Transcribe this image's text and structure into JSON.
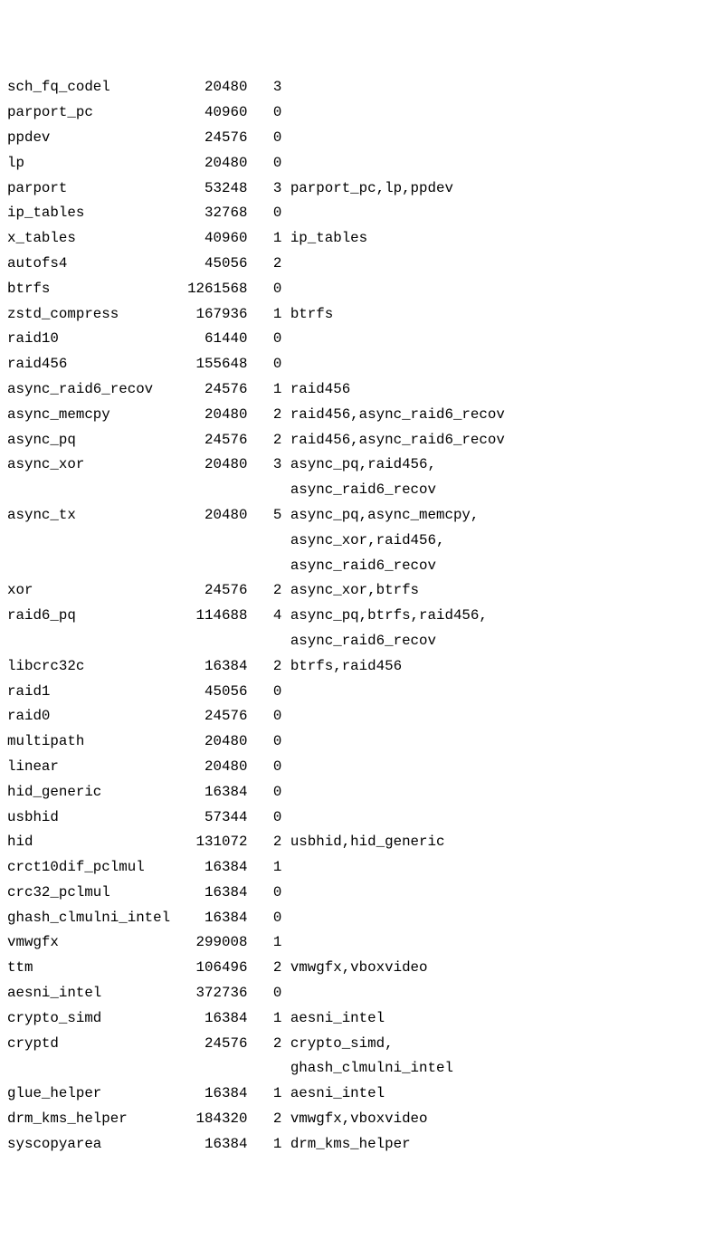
{
  "columns": {
    "nameWidth": 19,
    "sizeWidth": 9,
    "refWidth": 3,
    "usedWidth": 27
  },
  "modules": [
    {
      "name": "sch_fq_codel",
      "size": "20480",
      "ref": "3",
      "used": ""
    },
    {
      "name": "parport_pc",
      "size": "40960",
      "ref": "0",
      "used": ""
    },
    {
      "name": "ppdev",
      "size": "24576",
      "ref": "0",
      "used": ""
    },
    {
      "name": "lp",
      "size": "20480",
      "ref": "0",
      "used": ""
    },
    {
      "name": "parport",
      "size": "53248",
      "ref": "3",
      "used": "parport_pc,lp,ppdev"
    },
    {
      "name": "ip_tables",
      "size": "32768",
      "ref": "0",
      "used": ""
    },
    {
      "name": "x_tables",
      "size": "40960",
      "ref": "1",
      "used": "ip_tables"
    },
    {
      "name": "autofs4",
      "size": "45056",
      "ref": "2",
      "used": ""
    },
    {
      "name": "btrfs",
      "size": "1261568",
      "ref": "0",
      "used": ""
    },
    {
      "name": "zstd_compress",
      "size": "167936",
      "ref": "1",
      "used": "btrfs"
    },
    {
      "name": "raid10",
      "size": "61440",
      "ref": "0",
      "used": ""
    },
    {
      "name": "raid456",
      "size": "155648",
      "ref": "0",
      "used": ""
    },
    {
      "name": "async_raid6_recov",
      "size": "24576",
      "ref": "1",
      "used": "raid456"
    },
    {
      "name": "async_memcpy",
      "size": "20480",
      "ref": "2",
      "used": "raid456,async_raid6_recov"
    },
    {
      "name": "async_pq",
      "size": "24576",
      "ref": "2",
      "used": "raid456,async_raid6_recov"
    },
    {
      "name": "async_xor",
      "size": "20480",
      "ref": "3",
      "used": "async_pq,raid456,async_raid6_recov"
    },
    {
      "name": "async_tx",
      "size": "20480",
      "ref": "5",
      "used": "async_pq,async_memcpy,async_xor,raid456,async_raid6_recov"
    },
    {
      "name": "xor",
      "size": "24576",
      "ref": "2",
      "used": "async_xor,btrfs"
    },
    {
      "name": "raid6_pq",
      "size": "114688",
      "ref": "4",
      "used": "async_pq,btrfs,raid456,async_raid6_recov"
    },
    {
      "name": "libcrc32c",
      "size": "16384",
      "ref": "2",
      "used": "btrfs,raid456"
    },
    {
      "name": "raid1",
      "size": "45056",
      "ref": "0",
      "used": ""
    },
    {
      "name": "raid0",
      "size": "24576",
      "ref": "0",
      "used": ""
    },
    {
      "name": "multipath",
      "size": "20480",
      "ref": "0",
      "used": ""
    },
    {
      "name": "linear",
      "size": "20480",
      "ref": "0",
      "used": ""
    },
    {
      "name": "hid_generic",
      "size": "16384",
      "ref": "0",
      "used": ""
    },
    {
      "name": "usbhid",
      "size": "57344",
      "ref": "0",
      "used": ""
    },
    {
      "name": "hid",
      "size": "131072",
      "ref": "2",
      "used": "usbhid,hid_generic"
    },
    {
      "name": "crct10dif_pclmul",
      "size": "16384",
      "ref": "1",
      "used": ""
    },
    {
      "name": "crc32_pclmul",
      "size": "16384",
      "ref": "0",
      "used": ""
    },
    {
      "name": "ghash_clmulni_intel",
      "size": "16384",
      "ref": "0",
      "used": ""
    },
    {
      "name": "vmwgfx",
      "size": "299008",
      "ref": "1",
      "used": ""
    },
    {
      "name": "ttm",
      "size": "106496",
      "ref": "2",
      "used": "vmwgfx,vboxvideo"
    },
    {
      "name": "aesni_intel",
      "size": "372736",
      "ref": "0",
      "used": ""
    },
    {
      "name": "crypto_simd",
      "size": "16384",
      "ref": "1",
      "used": "aesni_intel"
    },
    {
      "name": "cryptd",
      "size": "24576",
      "ref": "2",
      "used": "crypto_simd,ghash_clmulni_intel"
    },
    {
      "name": "glue_helper",
      "size": "16384",
      "ref": "1",
      "used": "aesni_intel"
    },
    {
      "name": "drm_kms_helper",
      "size": "184320",
      "ref": "2",
      "used": "vmwgfx,vboxvideo"
    },
    {
      "name": "syscopyarea",
      "size": "16384",
      "ref": "1",
      "used": "drm_kms_helper"
    }
  ]
}
